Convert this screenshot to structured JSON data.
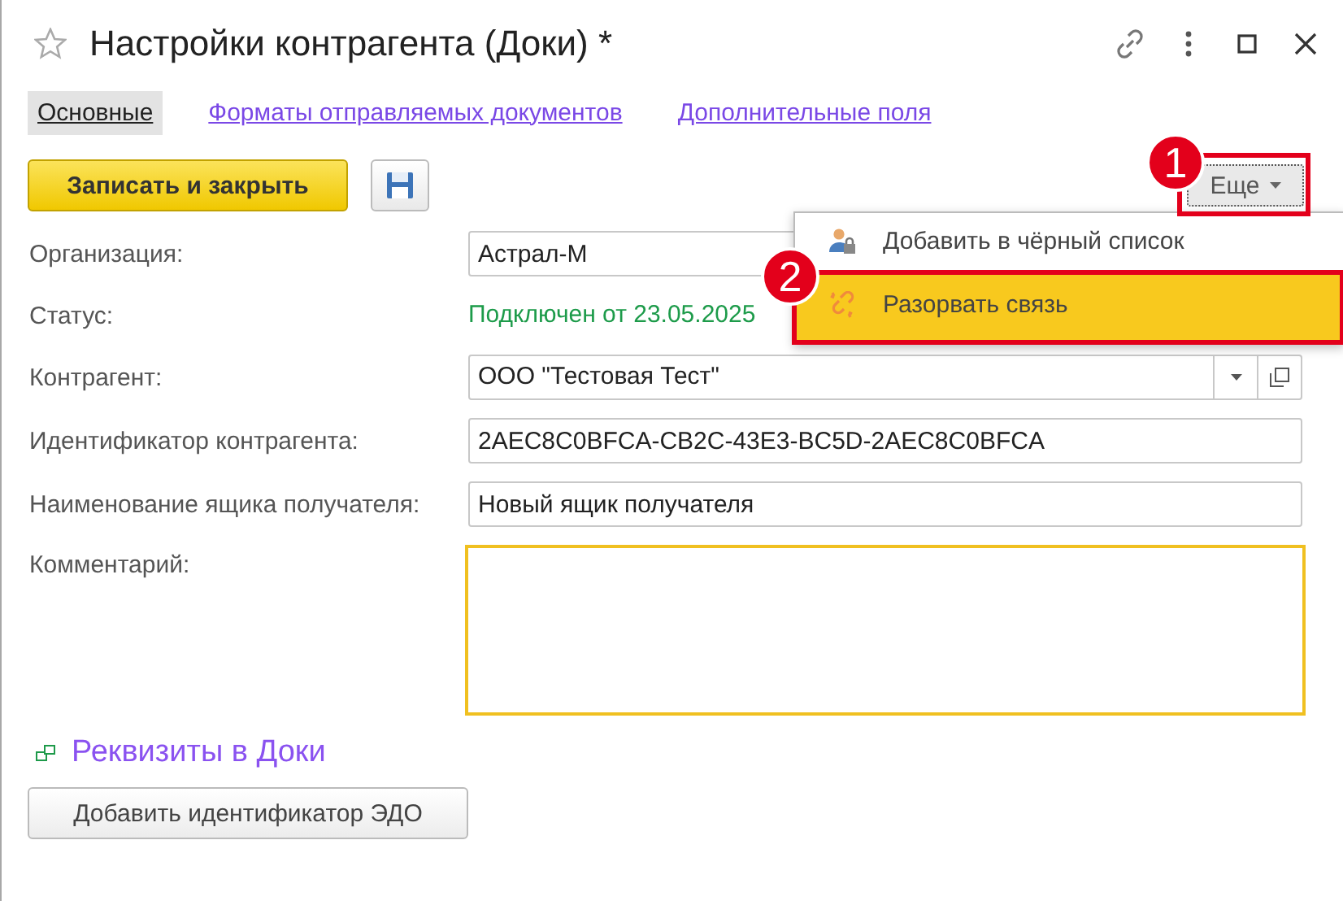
{
  "window": {
    "title": "Настройки контрагента (Доки) *",
    "favorite": false
  },
  "tabs": [
    {
      "label": "Основные",
      "selected": true
    },
    {
      "label": "Форматы отправляемых документов",
      "selected": false
    },
    {
      "label": "Дополнительные поля",
      "selected": false
    }
  ],
  "toolbar": {
    "primary_button": "Записать и закрыть",
    "more_button": "Еще"
  },
  "fields": [
    {
      "label": "Организация:",
      "kind": "input",
      "value": "Астрал-М",
      "focused": false
    },
    {
      "label": "Статус:",
      "kind": "status",
      "value": "Подключен от 23.05.2025"
    },
    {
      "label": "Контрагент:",
      "kind": "select",
      "value": "ООО \"Тестовая Тест\"",
      "focused": false
    },
    {
      "label": "Идентификатор контрагента:",
      "kind": "input",
      "value": "2AEC8C0BFCA-CB2C-43E3-BC5D-2AEC8C0BFCA",
      "focused": false
    },
    {
      "label": "Наименование ящика получателя:",
      "kind": "input",
      "value": "Новый ящик получателя",
      "focused": false
    },
    {
      "label": "Комментарий:",
      "kind": "textarea",
      "focused": true
    }
  ],
  "group": {
    "title": "Реквизиты в Доки",
    "button": "Добавить идентификатор ЭДО"
  },
  "menu": {
    "items": [
      {
        "label": "Добавить в чёрный список",
        "kind": "blacklist",
        "selected": false
      },
      {
        "label": "Разорвать связь",
        "kind": "unlink",
        "selected": true
      }
    ]
  },
  "annotations": [
    {
      "label": "1",
      "kind": "more_button"
    },
    {
      "label": "2",
      "kind": "menu_item"
    }
  ]
}
